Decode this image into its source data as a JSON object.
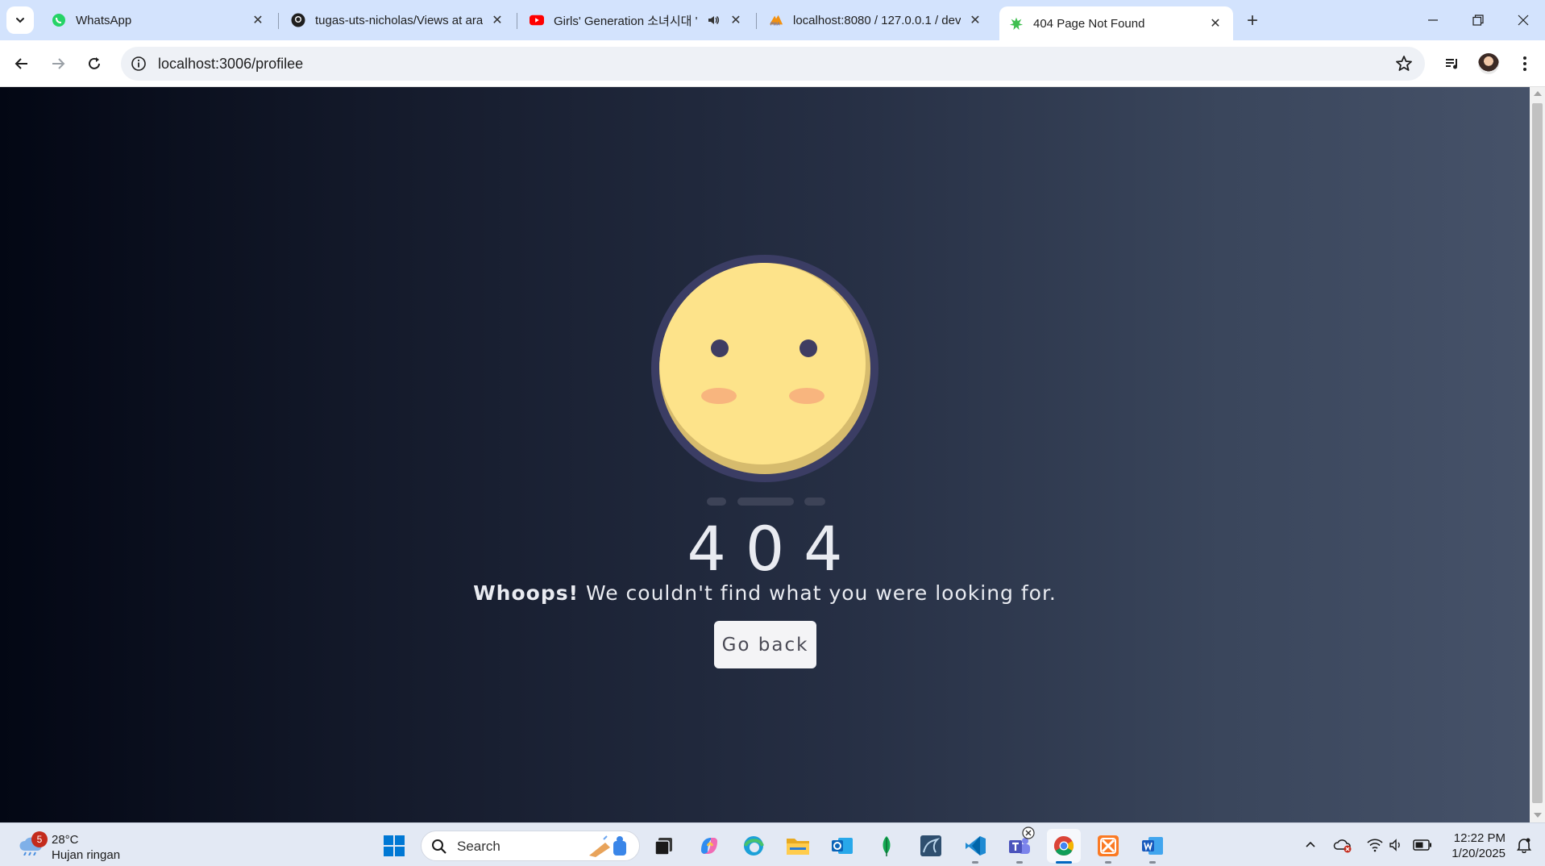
{
  "browser": {
    "tabs": [
      {
        "title": "WhatsApp",
        "icon": "whatsapp-icon"
      },
      {
        "title": "tugas-uts-nicholas/Views at ara",
        "icon": "github-icon"
      },
      {
        "title": "Girls' Generation 소녀시대 '",
        "icon": "youtube-icon"
      },
      {
        "title": "localhost:8080 / 127.0.0.1 / dev",
        "icon": "phpmyadmin-icon"
      },
      {
        "title": "404 Page Not Found",
        "icon": "page-favicon-icon"
      }
    ],
    "address": "localhost:3006/profilee"
  },
  "page": {
    "code": "404",
    "message_bold": "Whoops!",
    "message_rest": " We couldn't find what you were looking for.",
    "button_label": "Go back"
  },
  "taskbar": {
    "weather": {
      "badge": "5",
      "temp": "28°C",
      "condition": "Hujan ringan"
    },
    "search_label": "Search",
    "pinned_apps": [
      "task-view",
      "copilot",
      "edge",
      "file-explorer",
      "outlook",
      "mongodb-compass",
      "mysql-workbench",
      "vscode",
      "teams",
      "chrome",
      "xampp",
      "word"
    ],
    "clock": {
      "time": "12:22 PM",
      "date": "1/20/2025"
    }
  },
  "colors": {
    "tabstrip": "#d3e3fd",
    "page_gradient_start": "#030714",
    "page_gradient_end": "#465269",
    "face": "#fde38a",
    "face_ring": "#3b3d64",
    "blush": "#f8b57e"
  }
}
